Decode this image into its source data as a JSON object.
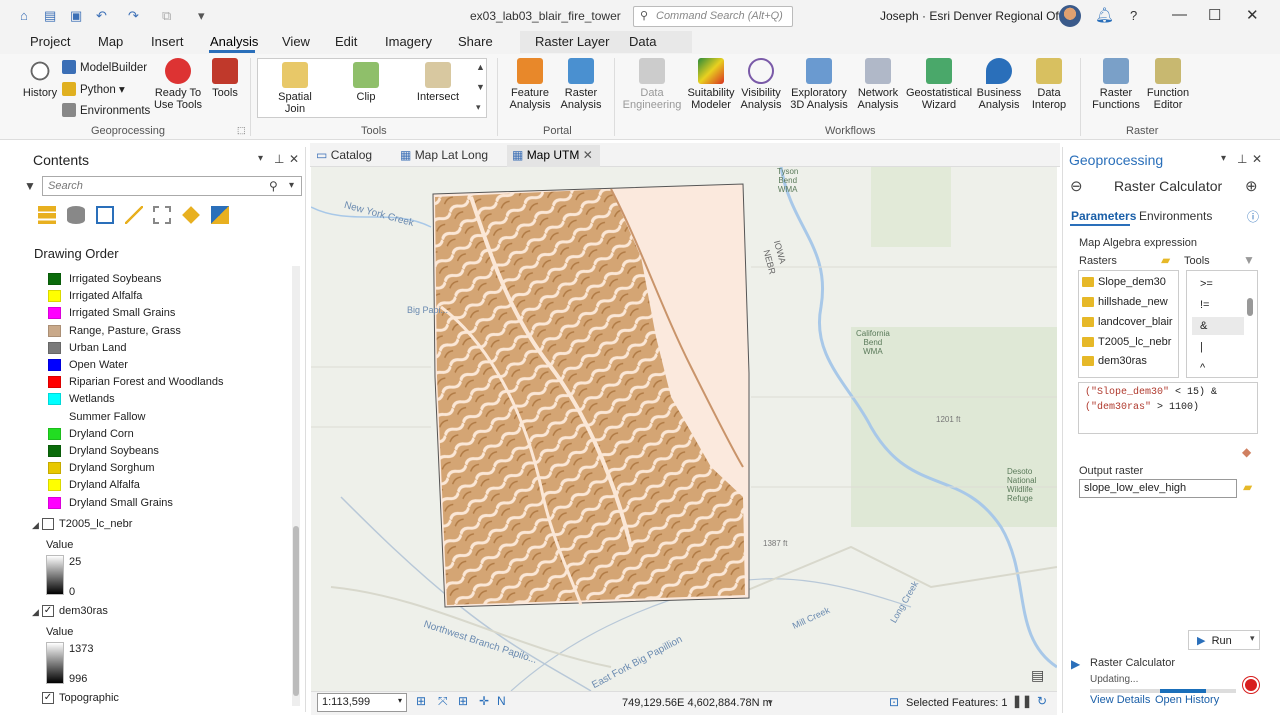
{
  "window": {
    "title": "ex03_lab03_blair_fire_tower",
    "command_search_placeholder": "Command Search (Alt+Q)",
    "user": "Joseph · Esri Denver Regional Office"
  },
  "menu_tabs": [
    "Project",
    "Map",
    "Insert",
    "Analysis",
    "View",
    "Edit",
    "Imagery",
    "Share"
  ],
  "context_tabs": [
    "Raster Layer",
    "Data"
  ],
  "ribbon": {
    "history": "History",
    "modelbuilder": "ModelBuilder",
    "python": "Python",
    "environments": "Environments",
    "ready_to_use": "Ready To\nUse Tools",
    "tools": "Tools",
    "gallery": [
      "Spatial Join",
      "Clip",
      "Intersect"
    ],
    "feature_analysis": "Feature\nAnalysis",
    "raster_analysis": "Raster\nAnalysis",
    "data_engineering": "Data\nEngineering",
    "suitability_modeler": "Suitability\nModeler",
    "visibility_analysis": "Visibility\nAnalysis",
    "exploratory_3d": "Exploratory\n3D Analysis",
    "network_analysis": "Network\nAnalysis",
    "geostatistical_wizard": "Geostatistical\nWizard",
    "business_analysis": "Business\nAnalysis",
    "data_interop": "Data\nInterop",
    "raster_functions": "Raster\nFunctions",
    "function_editor": "Function\nEditor",
    "groups": {
      "geoprocessing": "Geoprocessing",
      "tools": "Tools",
      "portal": "Portal",
      "workflows": "Workflows",
      "raster": "Raster"
    }
  },
  "contents": {
    "title": "Contents",
    "search_placeholder": "Search",
    "drawing_order": "Drawing Order",
    "legend": [
      {
        "label": "Irrigated Soybeans",
        "color": "#0b6b0b"
      },
      {
        "label": "Irrigated Alfalfa",
        "color": "#ffff00"
      },
      {
        "label": "Irrigated Small Grains",
        "color": "#ff00ff"
      },
      {
        "label": "Range, Pasture, Grass",
        "color": "#c9a98a"
      },
      {
        "label": "Urban Land",
        "color": "#7a7a7a"
      },
      {
        "label": "Open Water",
        "color": "#0000ff"
      },
      {
        "label": "Riparian Forest and Woodlands",
        "color": "#ff0000"
      },
      {
        "label": "Wetlands",
        "color": "#00ffff"
      },
      {
        "label": "Summer Fallow",
        "color": "#ffffff"
      },
      {
        "label": "Dryland Corn",
        "color": "#22dd22"
      },
      {
        "label": "Dryland Soybeans",
        "color": "#0b6b0b"
      },
      {
        "label": "Dryland Sorghum",
        "color": "#e8c800"
      },
      {
        "label": "Dryland Alfalfa",
        "color": "#ffff00"
      },
      {
        "label": "Dryland Small Grains",
        "color": "#ff00ff"
      }
    ],
    "layer1": {
      "name": "T2005_lc_nebr",
      "value_label": "Value",
      "max": "25",
      "min": "0"
    },
    "layer2": {
      "name": "dem30ras",
      "value_label": "Value",
      "max": "1373",
      "min": "996"
    },
    "layer3": {
      "name": "Topographic"
    }
  },
  "map": {
    "tabs": [
      "Catalog",
      "Map Lat Long",
      "Map UTM"
    ],
    "scale": "1:113,599",
    "coordinates": "749,129.56E 4,602,884.78N m",
    "selected_features": "Selected Features: 1",
    "labels": {
      "new_york_creek": "New York Creek",
      "big_papillion": "Big Papi...",
      "northwest_branch": "Northwest Branch Papilo...",
      "east_fork": "East Fork Big Papillion",
      "mill_creek": "Mill Creek",
      "long_creek": "Long Creek",
      "california_bend": "California\nBend\nWMA",
      "tyson_bend": "Tyson\nBend\nWMA",
      "desoto": "Desoto\nNational\nWildlife\nRefuge",
      "iowa": "IOWA",
      "nebr": "NEBR",
      "elev1": "1387 ft",
      "elev2": "1201 ft"
    }
  },
  "geoprocessing": {
    "title": "Geoprocessing",
    "tool": "Raster Calculator",
    "tab_parameters": "Parameters",
    "tab_environments": "Environments",
    "map_algebra_label": "Map Algebra expression",
    "rasters_label": "Rasters",
    "tools_label": "Tools",
    "rasters": [
      "Slope_dem30",
      "hillshade_new",
      "landcover_blair",
      "T2005_lc_nebr",
      "dem30ras"
    ],
    "operators": [
      ">=",
      "!=",
      "&",
      "|",
      "^"
    ],
    "expression_line1_a": "(\"Slope_dem30\"",
    "expression_line1_b": " < 15) &",
    "expression_line2_a": "(\"dem30ras\"",
    "expression_line2_b": " > 1100)",
    "output_label": "Output raster",
    "output_value": "slope_low_elev_high",
    "run": "Run",
    "progress_title": "Raster Calculator",
    "progress_status": "Updating...",
    "view_details": "View Details",
    "open_history": "Open History"
  }
}
